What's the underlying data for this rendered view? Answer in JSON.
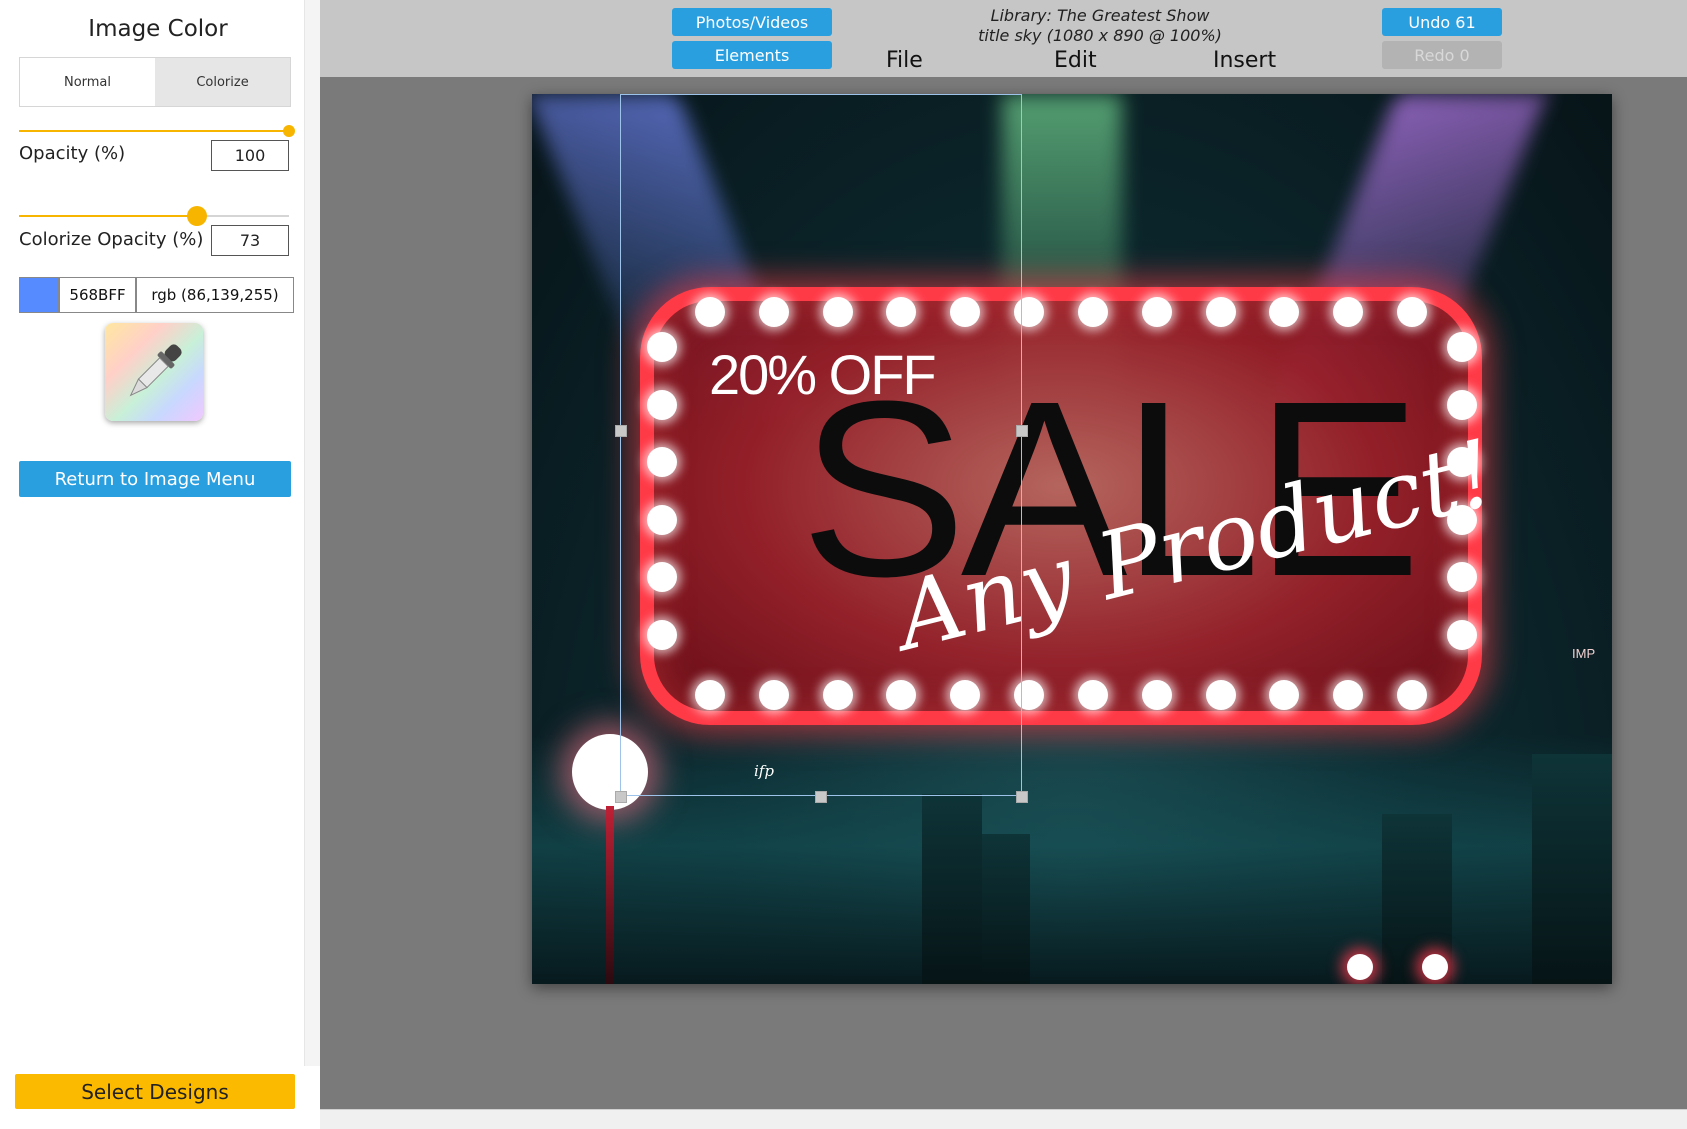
{
  "panel": {
    "title": "Image Color",
    "modes": [
      "Normal",
      "Colorize"
    ],
    "active_mode": "Colorize",
    "opacity_label": "Opacity (%)",
    "opacity_value": "100",
    "opacity_fraction": 1.0,
    "colorize_opacity_label": "Colorize Opacity (%)",
    "colorize_opacity_value": "73",
    "colorize_opacity_fraction": 0.66,
    "color_hex": "568BFF",
    "color_rgb": "rgb (86,139,255)",
    "color_swatch": "#568BFF",
    "picker_icon": "eyedropper-icon",
    "return_button": "Return to Image Menu",
    "select_designs": "Select Designs"
  },
  "toolbar": {
    "photos_videos": "Photos/Videos",
    "elements": "Elements",
    "library_line1": "Library: The Greatest Show",
    "library_line2": "title sky (1080 x 890 @ 100%)",
    "menu": [
      "File",
      "Edit",
      "Insert"
    ],
    "undo": "Undo 61",
    "redo": "Redo 0"
  },
  "design": {
    "headline_small": "20% OFF",
    "headline_big": "SALE",
    "script_text": "Any Product!",
    "logo_ifp": "ifp",
    "sign_imp": "IMP"
  },
  "colors": {
    "accent_blue": "#2a9fe0",
    "accent_yellow": "#f7b500",
    "neon_red": "#ff3a47"
  }
}
